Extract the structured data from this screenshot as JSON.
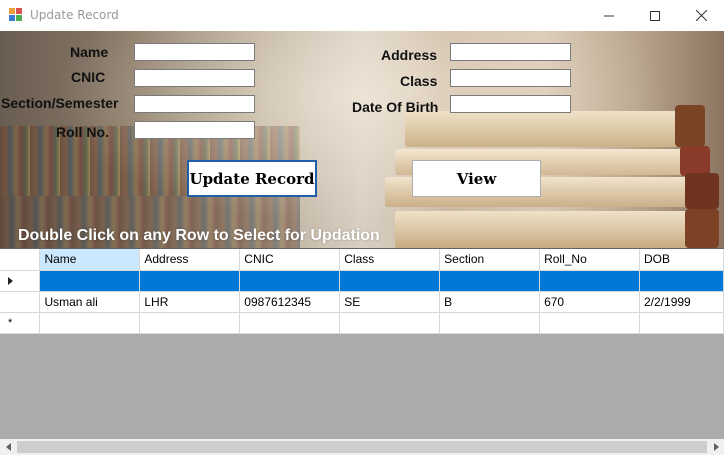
{
  "window": {
    "title": "Update Record",
    "minimize_glyph": "—",
    "maximize_glyph": "☐",
    "close_glyph": "✕"
  },
  "form": {
    "labels": {
      "name": "Name",
      "cnic": "CNIC",
      "section": "Section/Semester",
      "roll": "Roll No.",
      "address": "Address",
      "class": "Class",
      "dob": "Date Of Birth"
    },
    "values": {
      "name": "",
      "cnic": "",
      "section": "",
      "roll": "",
      "address": "",
      "class": "",
      "dob": ""
    },
    "update_button": "Update Record",
    "view_button": "View",
    "hint": "Double Click on any Row to Select for Updation"
  },
  "grid": {
    "columns": [
      "Name",
      "Address",
      "CNIC",
      "Class",
      "Section",
      "Roll_No",
      "DOB"
    ],
    "selected_row": [
      "",
      "",
      "",
      "",
      "",
      "",
      ""
    ],
    "rows": [
      [
        "Usman ali",
        "LHR",
        "0987612345",
        "SE",
        "B",
        "670",
        "2/2/1999"
      ]
    ],
    "new_row_marker": "*",
    "current_row_marker": "▶"
  },
  "colors": {
    "selection": "#0078d7",
    "header_highlight": "#cce8ff",
    "grid_background": "#ababab",
    "button_border": "#1f5fa8"
  }
}
